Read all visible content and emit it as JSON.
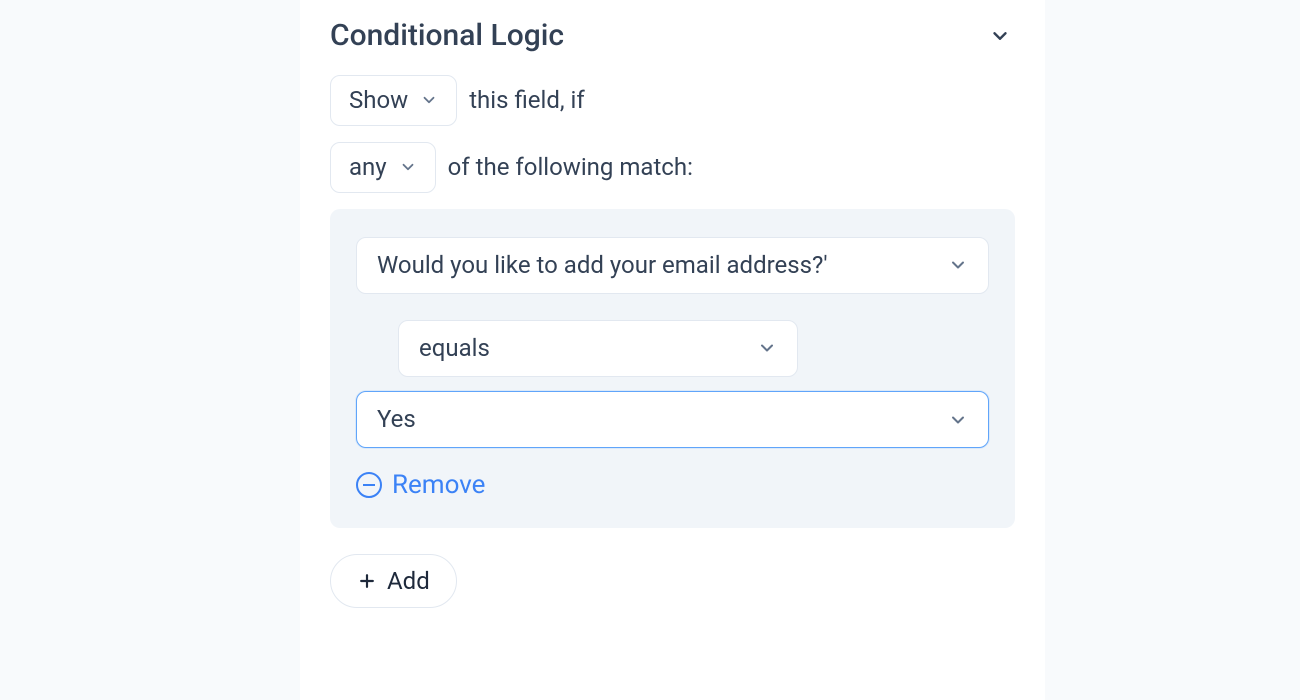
{
  "section": {
    "title": "Conditional Logic"
  },
  "sentence": {
    "action_select": "Show",
    "text_after_action": "this field, if",
    "match_select": "any",
    "text_after_match": "of the following match:"
  },
  "rule": {
    "field_select": "Would you like to add your email address?'",
    "operator_select": "equals",
    "value_select": "Yes",
    "remove_label": "Remove"
  },
  "add_button_label": "Add"
}
